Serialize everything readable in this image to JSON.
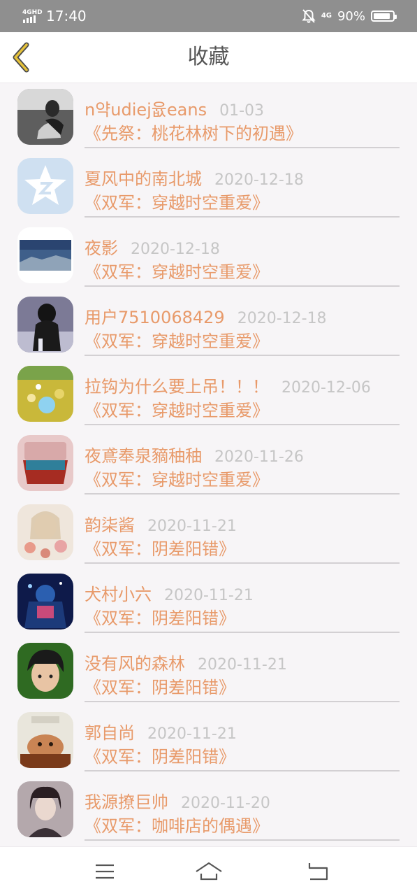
{
  "status_bar": {
    "network_left": "4GHD",
    "time": "17:40",
    "network_right": "4G",
    "battery": "90%",
    "battery_level": 0.9
  },
  "header": {
    "title": "收藏",
    "back_icon": "chevron-left-icon"
  },
  "items": [
    {
      "name": "n약udiej윲eans",
      "date": "01-03",
      "title": "《先祭：桃花林树下的初遇》"
    },
    {
      "name": "夏风中的南北城",
      "date": "2020-12-18",
      "title": "《双军：穿越时空重爱》"
    },
    {
      "name": "夜影",
      "date": "2020-12-18",
      "title": "《双军：穿越时空重爱》"
    },
    {
      "name": "用户7510068429",
      "date": "2020-12-18",
      "title": "《双军：穿越时空重爱》"
    },
    {
      "name": "拉钩为什么要上吊！！！",
      "date": "2020-12-06",
      "title": "《双军：穿越时空重爱》"
    },
    {
      "name": "夜鳶奉泉豴秞秞",
      "date": "2020-11-26",
      "title": "《双军：穿越时空重爱》"
    },
    {
      "name": "韵柒酱",
      "date": "2020-11-21",
      "title": "《双军：阴差阳错》"
    },
    {
      "name": "犬村小六",
      "date": "2020-11-21",
      "title": "《双军：阴差阳错》"
    },
    {
      "name": "没有风的森林",
      "date": "2020-11-21",
      "title": "《双军：阴差阳错》"
    },
    {
      "name": "郭自尚",
      "date": "2020-11-21",
      "title": "《双军：阴差阳错》"
    },
    {
      "name": "我源撩巨帅",
      "date": "2020-11-20",
      "title": "《双军：咖啡店的偶遇》"
    }
  ],
  "bottom_nav": {
    "menu_icon": "menu-icon",
    "home_icon": "home-icon",
    "back_icon": "return-icon"
  },
  "colors": {
    "accent": "#e89a6a",
    "date": "#c6c6c6",
    "status_bar": "#8f8f8f",
    "back_arrow": "#e6c23a"
  }
}
